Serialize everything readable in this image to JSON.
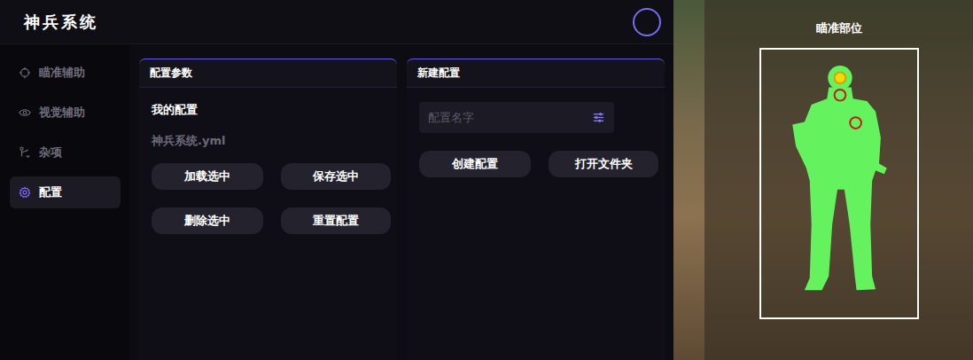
{
  "window": {
    "title": "神兵系统"
  },
  "sidebar": {
    "items": [
      {
        "label": "瞄准辅助",
        "selected": false
      },
      {
        "label": "视觉辅助",
        "selected": false
      },
      {
        "label": "杂项",
        "selected": false
      },
      {
        "label": "配置",
        "selected": true
      }
    ]
  },
  "config_params": {
    "title": "配置参数",
    "section_label": "我的配置",
    "selected_file": "神兵系统.yml",
    "buttons": [
      "加载选中",
      "保存选中",
      "删除选中",
      "重置配置"
    ]
  },
  "new_config": {
    "title": "新建配置",
    "input": {
      "placeholder": "配置名字"
    },
    "buttons": [
      "创建配置",
      "打开文件夹"
    ]
  },
  "aim_overlay": {
    "title": "瞄准部位",
    "points": [
      {
        "selected": true
      },
      {
        "selected": false
      },
      {
        "selected": false
      }
    ]
  }
}
